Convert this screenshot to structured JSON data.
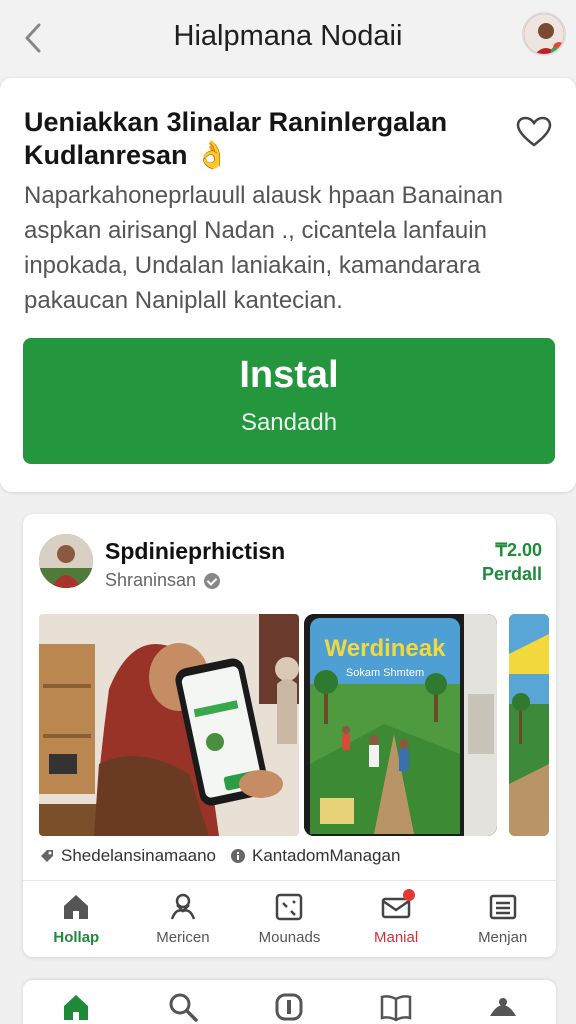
{
  "header": {
    "title": "Hialpmana Nodaii"
  },
  "app": {
    "title": "Ueniakkan 3linalar Raninlergalan Kudlanresan",
    "title_emoji": "👌",
    "description": "Naparkahoneprlauull alausk hpaan Banainan aspkan airisangl Nadan ., cicantela lanfauin inpokada, Undalan laniakain, kamandarara pakaucan Naniplall kantecian.",
    "install_label": "Instal",
    "install_sub": "Sandadh"
  },
  "developer": {
    "name": "Spdinieprhictisn",
    "subtitle": "Shraninsan",
    "price": "₸2.00",
    "period": "Perdall"
  },
  "screenshot": {
    "promo_title": "Werdineak",
    "promo_sub": "Sokam Shmtem"
  },
  "tags": [
    {
      "label": "Shedelansinamaano",
      "icon": "tag-icon"
    },
    {
      "label": "KantadomManagan",
      "icon": "info-icon"
    }
  ],
  "inner_nav": [
    {
      "label": "Hollap",
      "icon": "home-icon",
      "state": "active"
    },
    {
      "label": "Mericen",
      "icon": "people-icon",
      "state": "normal"
    },
    {
      "label": "Mounads",
      "icon": "board-icon",
      "state": "normal"
    },
    {
      "label": "Manial",
      "icon": "mail-icon",
      "state": "alert"
    },
    {
      "label": "Menjan",
      "icon": "list-icon",
      "state": "normal"
    }
  ],
  "bottom_nav": [
    {
      "icon": "home-icon",
      "state": "active"
    },
    {
      "icon": "search-icon",
      "state": "normal"
    },
    {
      "icon": "apps-icon",
      "state": "normal"
    },
    {
      "icon": "book-icon",
      "state": "normal"
    },
    {
      "icon": "profile-icon",
      "state": "normal"
    }
  ],
  "colors": {
    "accent": "#24963e",
    "alert": "#d3303a",
    "text": "#1f1f1f"
  }
}
